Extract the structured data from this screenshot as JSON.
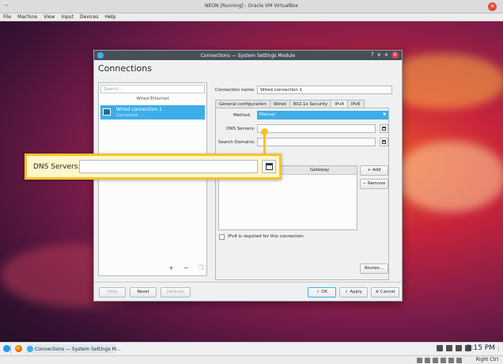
{
  "vbox": {
    "window_title": "NEON [Running] - Oracle VM VirtualBox",
    "minimize_glyph": "–",
    "close_glyph": "✕",
    "menu": [
      "File",
      "Machine",
      "View",
      "Input",
      "Devices",
      "Help"
    ],
    "host_key": "Right Ctrl"
  },
  "dialog": {
    "title": "Connections — System Settings Module",
    "window_controls": [
      "?",
      "∨",
      "∧",
      "✕"
    ],
    "heading": "Connections",
    "search_placeholder": "Search...",
    "group_header": "Wired Ethernet",
    "connection": {
      "name": "Wired connection 1",
      "state": "Connected"
    },
    "list_actions": [
      "+",
      "−",
      "❐"
    ],
    "connection_name_label": "Connection name:",
    "connection_name_value": "Wired connection 1",
    "tabs": [
      "General configuration",
      "Wired",
      "802.1x Security",
      "IPv4",
      "IPv6"
    ],
    "active_tab": "IPv4",
    "method_label": "Method:",
    "method_value": "Manual",
    "dns_label": "DNS Servers:",
    "search_domains_label": "Search Domains:",
    "gateway_header": "Gateway",
    "add_button": "+ Add",
    "remove_button": "− Remove",
    "ipv4_required_label": "IPv4 is required for this connection",
    "routes_button": "Routes...",
    "help_button": "Help",
    "reset_button": "Reset",
    "defaults_button": "Defaults",
    "ok_button": "✓ OK",
    "apply_button": "✓ Apply",
    "cancel_button": "⊘ Cancel"
  },
  "callout": {
    "label": "DNS Servers:",
    "highlight_color": "#f6c22c"
  },
  "taskbar": {
    "task_label": "Connections — System Settings M...",
    "clock": "3:15 PM"
  },
  "colors": {
    "accent": "#3daee9",
    "titlebar": "#475057",
    "highlight": "#f6c22c"
  },
  "icons": [
    "kde-menu-icon",
    "firefox-icon",
    "network-icon",
    "calendar-picker-icon"
  ]
}
